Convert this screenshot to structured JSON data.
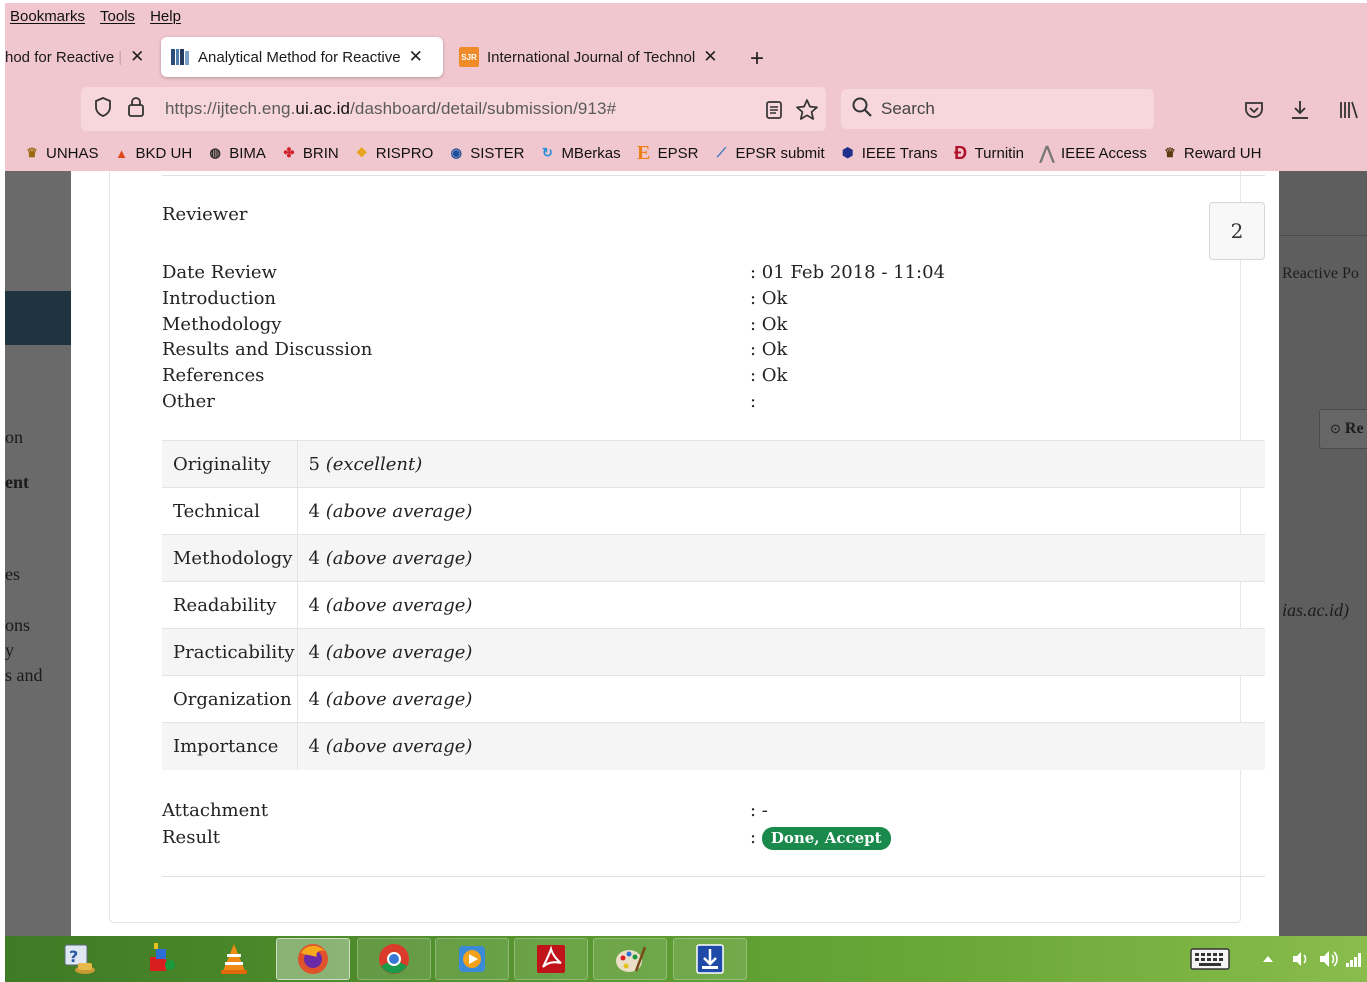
{
  "menubar": [
    "Bookmarks",
    "Tools",
    "Help"
  ],
  "tabs": [
    {
      "title": "hod for Reactive",
      "state": "partial"
    },
    {
      "title": "Analytical Method for Reactive",
      "state": "active"
    },
    {
      "title": "International Journal of Technol",
      "state": "inactive"
    }
  ],
  "url": {
    "prefix": "https://ijtech.eng.",
    "domain": "ui.ac.id",
    "path": "/dashboard/detail/submission/913#"
  },
  "search": {
    "placeholder": "Search"
  },
  "bookmarks": [
    "UNHAS",
    "BKD UH",
    "BIMA",
    "BRIN",
    "RISPRO",
    "SISTER",
    "MBerkas",
    "EPSR",
    "EPSR submit",
    "IEEE Trans",
    "Turnitin",
    "IEEE Access",
    "Reward UH"
  ],
  "background": {
    "left_fragments": [
      "on",
      "ent",
      "es",
      "ons",
      "y",
      "s and"
    ],
    "right_fragments": [
      "Reactive Po",
      "Re",
      "ias.ac.id)"
    ]
  },
  "review": {
    "heading": "Reviewer",
    "number": "2",
    "fields": [
      {
        "label": "Date Review",
        "value": ": 01 Feb 2018 - 11:04"
      },
      {
        "label": "Introduction",
        "value": ": Ok"
      },
      {
        "label": "Methodology",
        "value": ": Ok"
      },
      {
        "label": "Results and Discussion",
        "value": ": Ok"
      },
      {
        "label": "References",
        "value": ": Ok"
      },
      {
        "label": "Other",
        "value": ":"
      }
    ],
    "scores": [
      {
        "criterion": "Originality",
        "score": "5",
        "desc": "(excellent)"
      },
      {
        "criterion": "Technical",
        "score": "4",
        "desc": "(above average)"
      },
      {
        "criterion": "Methodology",
        "score": "4",
        "desc": "(above average)"
      },
      {
        "criterion": "Readability",
        "score": "4",
        "desc": "(above average)"
      },
      {
        "criterion": "Practicability",
        "score": "4",
        "desc": "(above average)"
      },
      {
        "criterion": "Organization",
        "score": "4",
        "desc": "(above average)"
      },
      {
        "criterion": "Importance",
        "score": "4",
        "desc": "(above average)"
      }
    ],
    "attachment": {
      "label": "Attachment",
      "value": ": -"
    },
    "result": {
      "label": "Result",
      "prefix": ":",
      "badge": "Done, Accept",
      "badge_color": "#1a8a4c"
    }
  },
  "colors": {
    "chrome": "#f1c7cf",
    "taskbar": "#5a9a30"
  },
  "taskbar": [
    "help-support-icon",
    "program-installer-icon",
    "vlc-icon",
    "firefox-icon",
    "chrome-icon",
    "media-player-icon",
    "adobe-reader-icon",
    "paint-icon",
    "download-manager-icon"
  ],
  "tray": [
    "keyboard-icon",
    "tray-arrow-icon",
    "speaker-icon",
    "volume-icon",
    "network-icon"
  ]
}
